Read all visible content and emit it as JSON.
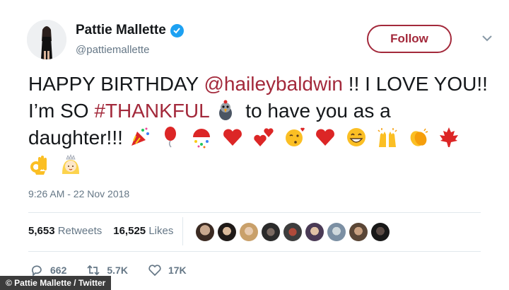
{
  "author": {
    "name": "Pattie Mallette",
    "handle": "@pattiemallette",
    "avatar_icon": "profile-photo",
    "verified_icon": "verified-badge-icon"
  },
  "follow_button": {
    "label": "Follow"
  },
  "tweet": {
    "text_parts": {
      "p1": "HAPPY BIRTHDAY ",
      "mention": "@haileybaldwin",
      "p2": " !! I LOVE YOU!! I’m SO ",
      "hashtag": "#THANKFUL",
      "p3": " to have you as a daughter!!! "
    },
    "emojis": [
      "turkey",
      "party-popper",
      "balloon",
      "confetti-ball",
      "red-heart",
      "two-hearts",
      "face-blowing-kiss",
      "red-heart",
      "grinning-face",
      "raising-hands",
      "clapping-hands",
      "maple-leaf",
      "ok-hand",
      "princess"
    ],
    "timestamp": "9:26 AM - 22 Nov 2018"
  },
  "stats": {
    "retweets_count": "5,653",
    "retweets_label": "Retweets",
    "likes_count": "16,525",
    "likes_label": "Likes"
  },
  "actions": {
    "replies": "662",
    "retweets": "5.7K",
    "likes": "17K"
  },
  "credit": "© Pattie Mallette / Twitter",
  "colors": {
    "accent": "#a3293b",
    "text": "#14171a",
    "muted": "#657786",
    "verified": "#1da1f2"
  }
}
